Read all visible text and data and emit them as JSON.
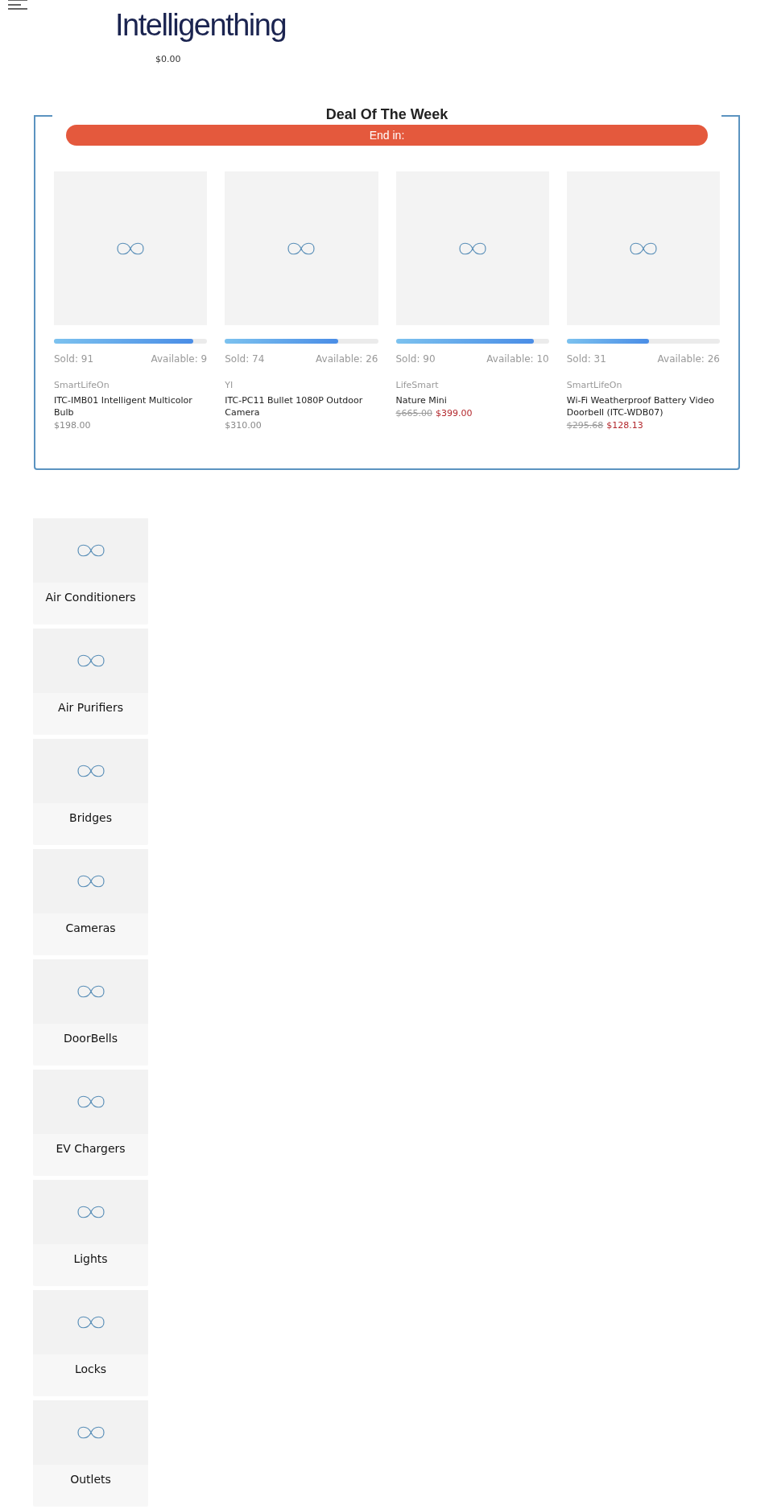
{
  "header": {
    "logo": "Intelligenthing",
    "cart_total": "$0.00"
  },
  "deal": {
    "title": "Deal Of The Week",
    "countdown_label": "End in:",
    "products": [
      {
        "level": 0.91,
        "sold": "Sold: 91",
        "available": "Available: 9",
        "brand": "SmartLifeOn",
        "name": "ITC-IMB01 Intelligent Multicolor Bulb",
        "price": "$198.00"
      },
      {
        "level": 0.74,
        "sold": "Sold: 74",
        "available": "Available: 26",
        "brand": "YI",
        "name": "ITC-PC11 Bullet 1080P Outdoor Camera",
        "price": "$310.00"
      },
      {
        "level": 0.9,
        "sold": "Sold: 90",
        "available": "Available: 10",
        "brand": "LifeSmart",
        "name": "Nature Mini",
        "old_price": "$665.00",
        "price": "$399.00"
      },
      {
        "level": 0.54,
        "sold": "Sold: 31",
        "available": "Available: 26",
        "brand": "SmartLifeOn",
        "name": "Wi-Fi Weatherproof Battery Video Doorbell (ITC-WDB07)",
        "old_price": "$295.68",
        "price": "$128.13"
      }
    ]
  },
  "categories": [
    {
      "label": "Air Conditioners"
    },
    {
      "label": "Air Purifiers"
    },
    {
      "label": "Bridges"
    },
    {
      "label": "Cameras"
    },
    {
      "label": "DoorBells"
    },
    {
      "label": "EV Chargers"
    },
    {
      "label": "Lights"
    },
    {
      "label": "Locks"
    },
    {
      "label": "Outlets"
    }
  ]
}
